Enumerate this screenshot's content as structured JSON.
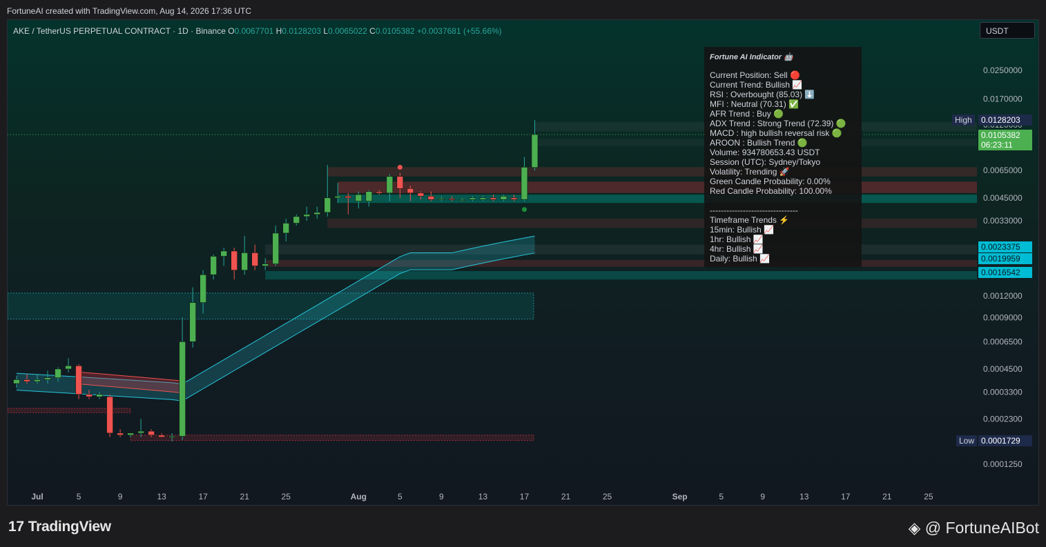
{
  "caption": "FortuneAI created with TradingView.com, Aug 14, 2026 17:36 UTC",
  "header": {
    "symbol": "AKE / TetherUS PERPETUAL CONTRACT · 1D · Binance",
    "o_label": "O",
    "o": "0.0067701",
    "h_label": "H",
    "h": "0.0128203",
    "l_label": "L",
    "l": "0.0065022",
    "c_label": "C",
    "c": "0.0105382",
    "change": "+0.0037681 (+55.66%)"
  },
  "currency": "USDT",
  "indicator": {
    "title": "Fortune AI Indicator 🤖",
    "lines": [
      "Current Position: Sell 🔴",
      "Current Trend: Bullish 📈",
      "RSI : Overbought (85.03) ⬇️",
      "MFI : Neutral (70.31) ✅",
      "AFR Trend : Buy 🟢",
      "ADX Trend : Strong Trend (72.39) 🟢",
      "MACD : high bullish reversal risk 🟢",
      "AROON : Bullish Trend 🟢",
      "Volume: 934780653.43 USDT",
      "Session (UTC): Sydney/Tokyo",
      "Volatility: Trending 🚀",
      "Green Candle Probability: 0.00%",
      "Red Candle Probability: 100.00%"
    ],
    "separator": "--------------------------------",
    "tf_title": "Timeframe Trends ⚡",
    "tf_lines": [
      "15min: Bullish 📈",
      "1hr: Bullish 📈",
      "4hr: Bullish 📈",
      "Daily: Bullish 📈"
    ]
  },
  "price_labels": {
    "high_tag": "High",
    "high": "0.0128203",
    "last": "0.0105382",
    "countdown": "06:23:11",
    "level1": "0.0023375",
    "level2": "0.0019959",
    "level3": "0.0016542",
    "low_tag": "Low",
    "low": "0.0001729"
  },
  "colors": {
    "up": "#26a69a",
    "down": "#ef5350",
    "body_up": "#4caf50",
    "band": "#26c6da",
    "zone_red": "#f23645"
  },
  "chart_data": {
    "type": "candlestick",
    "scale": "log",
    "y_ticks": [
      "0.0250000",
      "0.0170000",
      "0.0120000",
      "0.0065000",
      "0.0045000",
      "0.0033000",
      "0.0012000",
      "0.0009000",
      "0.0006500",
      "0.0004500",
      "0.0003300",
      "0.0002300",
      "0.0001250"
    ],
    "x_ticks": [
      "Jul",
      "5",
      "9",
      "13",
      "17",
      "21",
      "25",
      "Aug",
      "5",
      "9",
      "13",
      "17",
      "21",
      "25",
      "Sep",
      "5",
      "9",
      "13",
      "17",
      "21",
      "25"
    ],
    "x_tick_days": [
      0,
      4,
      8,
      12,
      16,
      20,
      24,
      31,
      35,
      39,
      43,
      47,
      51,
      55,
      62,
      66,
      70,
      74,
      78,
      82,
      86
    ],
    "candles": [
      {
        "day": -2,
        "o": 0.00037,
        "h": 0.00041,
        "l": 0.00035,
        "c": 0.00039
      },
      {
        "day": -1,
        "o": 0.00039,
        "h": 0.00042,
        "l": 0.00037,
        "c": 0.00038
      },
      {
        "day": 0,
        "o": 0.00038,
        "h": 0.00042,
        "l": 0.00037,
        "c": 0.00039
      },
      {
        "day": 1,
        "o": 0.00039,
        "h": 0.00044,
        "l": 0.00037,
        "c": 0.0004
      },
      {
        "day": 2,
        "o": 0.0004,
        "h": 0.00046,
        "l": 0.00038,
        "c": 0.00045
      },
      {
        "day": 3,
        "o": 0.00045,
        "h": 0.00052,
        "l": 0.00043,
        "c": 0.00047
      },
      {
        "day": 4,
        "o": 0.00047,
        "h": 0.00048,
        "l": 0.0003,
        "c": 0.00032
      },
      {
        "day": 5,
        "o": 0.00032,
        "h": 0.00034,
        "l": 0.0003,
        "c": 0.00031
      },
      {
        "day": 6,
        "o": 0.00031,
        "h": 0.00033,
        "l": 0.0003,
        "c": 0.00032
      },
      {
        "day": 7,
        "o": 0.00031,
        "h": 0.00032,
        "l": 0.00018,
        "c": 0.00019
      },
      {
        "day": 8,
        "o": 0.00019,
        "h": 0.0002,
        "l": 0.00018,
        "c": 0.000185
      },
      {
        "day": 9,
        "o": 0.000185,
        "h": 0.00019,
        "l": 0.00018,
        "c": 0.00019
      },
      {
        "day": 10,
        "o": 0.00019,
        "h": 0.00023,
        "l": 0.00018,
        "c": 0.000195
      },
      {
        "day": 11,
        "o": 0.000195,
        "h": 0.0002,
        "l": 0.00018,
        "c": 0.000185
      },
      {
        "day": 12,
        "o": 0.000185,
        "h": 0.00019,
        "l": 0.00018,
        "c": 0.00018
      },
      {
        "day": 13,
        "o": 0.00018,
        "h": 0.00019,
        "l": 0.00017,
        "c": 0.000182
      },
      {
        "day": 14,
        "o": 0.000182,
        "h": 0.0009,
        "l": 0.000173,
        "c": 0.00065
      },
      {
        "day": 15,
        "o": 0.00065,
        "h": 0.00135,
        "l": 0.0006,
        "c": 0.0011
      },
      {
        "day": 16,
        "o": 0.0011,
        "h": 0.0017,
        "l": 0.00095,
        "c": 0.0016
      },
      {
        "day": 17,
        "o": 0.0016,
        "h": 0.0021,
        "l": 0.0015,
        "c": 0.00205
      },
      {
        "day": 18,
        "o": 0.00205,
        "h": 0.0023,
        "l": 0.0018,
        "c": 0.0022
      },
      {
        "day": 19,
        "o": 0.0022,
        "h": 0.0023,
        "l": 0.0015,
        "c": 0.0017
      },
      {
        "day": 20,
        "o": 0.0017,
        "h": 0.0027,
        "l": 0.0016,
        "c": 0.00215
      },
      {
        "day": 21,
        "o": 0.00215,
        "h": 0.0024,
        "l": 0.0017,
        "c": 0.0018
      },
      {
        "day": 22,
        "o": 0.0018,
        "h": 0.002,
        "l": 0.0017,
        "c": 0.00185
      },
      {
        "day": 23,
        "o": 0.00185,
        "h": 0.0031,
        "l": 0.0018,
        "c": 0.0028
      },
      {
        "day": 24,
        "o": 0.0028,
        "h": 0.0034,
        "l": 0.0025,
        "c": 0.0032
      },
      {
        "day": 25,
        "o": 0.0032,
        "h": 0.0036,
        "l": 0.0031,
        "c": 0.0035
      },
      {
        "day": 26,
        "o": 0.0035,
        "h": 0.004,
        "l": 0.0033,
        "c": 0.0036
      },
      {
        "day": 27,
        "o": 0.0036,
        "h": 0.004,
        "l": 0.0034,
        "c": 0.0037
      },
      {
        "day": 28,
        "o": 0.0037,
        "h": 0.007,
        "l": 0.0035,
        "c": 0.0045
      },
      {
        "day": 29,
        "o": 0.0045,
        "h": 0.0055,
        "l": 0.0042,
        "c": 0.0046
      },
      {
        "day": 30,
        "o": 0.0046,
        "h": 0.0048,
        "l": 0.0036,
        "c": 0.0045
      },
      {
        "day": 31,
        "o": 0.0043,
        "h": 0.0049,
        "l": 0.0039,
        "c": 0.0047
      },
      {
        "day": 32,
        "o": 0.0043,
        "h": 0.005,
        "l": 0.004,
        "c": 0.0049
      },
      {
        "day": 33,
        "o": 0.0049,
        "h": 0.005,
        "l": 0.0047,
        "c": 0.0048
      },
      {
        "day": 34,
        "o": 0.0048,
        "h": 0.0062,
        "l": 0.0043,
        "c": 0.006
      },
      {
        "day": 35,
        "o": 0.006,
        "h": 0.0063,
        "l": 0.0045,
        "c": 0.0051
      },
      {
        "day": 36,
        "o": 0.0051,
        "h": 0.0053,
        "l": 0.0043,
        "c": 0.0048
      },
      {
        "day": 37,
        "o": 0.0048,
        "h": 0.0049,
        "l": 0.0044,
        "c": 0.0046
      },
      {
        "day": 38,
        "o": 0.0046,
        "h": 0.0049,
        "l": 0.0043,
        "c": 0.0044
      },
      {
        "day": 39,
        "o": 0.0044,
        "h": 0.0046,
        "l": 0.0043,
        "c": 0.00445
      },
      {
        "day": 40,
        "o": 0.00445,
        "h": 0.0046,
        "l": 0.0043,
        "c": 0.0044
      },
      {
        "day": 41,
        "o": 0.0044,
        "h": 0.0045,
        "l": 0.0043,
        "c": 0.0044
      },
      {
        "day": 42,
        "o": 0.0044,
        "h": 0.0046,
        "l": 0.0043,
        "c": 0.0045
      },
      {
        "day": 43,
        "o": 0.0044,
        "h": 0.0046,
        "l": 0.0043,
        "c": 0.0045
      },
      {
        "day": 44,
        "o": 0.0045,
        "h": 0.0047,
        "l": 0.0043,
        "c": 0.0044
      },
      {
        "day": 45,
        "o": 0.0044,
        "h": 0.0047,
        "l": 0.0043,
        "c": 0.0046
      },
      {
        "day": 46,
        "o": 0.0045,
        "h": 0.0047,
        "l": 0.0043,
        "c": 0.0044
      },
      {
        "day": 47,
        "o": 0.0044,
        "h": 0.0078,
        "l": 0.0043,
        "c": 0.0068
      },
      {
        "day": 48,
        "o": 0.0067701,
        "h": 0.0128203,
        "l": 0.0065022,
        "c": 0.0105382
      }
    ],
    "sell_marker_day": 35,
    "buy_marker_day": 47
  }
}
